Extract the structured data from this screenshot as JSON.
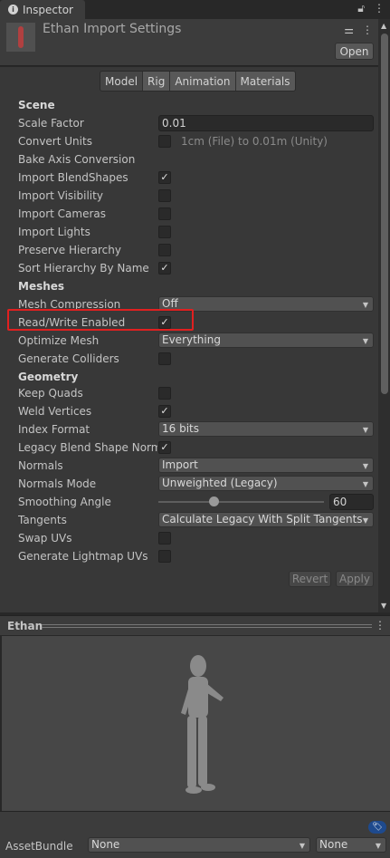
{
  "tab": {
    "title": "Inspector",
    "icon": "info-icon"
  },
  "header": {
    "title": "Ethan Import Settings",
    "open_label": "Open",
    "icons": [
      "lock-icon",
      "more-icon",
      "sliders-icon"
    ]
  },
  "tabs": [
    {
      "label": "Model",
      "active": true
    },
    {
      "label": "Rig"
    },
    {
      "label": "Animation"
    },
    {
      "label": "Materials"
    }
  ],
  "rows": [
    {
      "type": "header",
      "label": "Scene"
    },
    {
      "label": "Scale Factor",
      "type": "text",
      "value": "0.01"
    },
    {
      "label": "Convert Units",
      "type": "check",
      "checked": false,
      "note": "1cm (File) to 0.01m (Unity)"
    },
    {
      "label": "Bake Axis Conversion",
      "type": "none"
    },
    {
      "label": "Import BlendShapes",
      "type": "check",
      "checked": true
    },
    {
      "label": "Import Visibility",
      "type": "check",
      "checked": false
    },
    {
      "label": "Import Cameras",
      "type": "check",
      "checked": false
    },
    {
      "label": "Import Lights",
      "type": "check",
      "checked": false
    },
    {
      "label": "Preserve Hierarchy",
      "type": "check",
      "checked": false
    },
    {
      "label": "Sort Hierarchy By Name",
      "type": "check",
      "checked": true
    },
    {
      "type": "header",
      "label": "Meshes"
    },
    {
      "label": "Mesh Compression",
      "type": "dropdown",
      "value": "Off"
    },
    {
      "label": "Read/Write Enabled",
      "type": "check",
      "checked": true,
      "highlighted": true
    },
    {
      "label": "Optimize Mesh",
      "type": "dropdown",
      "value": "Everything"
    },
    {
      "label": "Generate Colliders",
      "type": "check",
      "checked": false
    },
    {
      "type": "header",
      "label": "Geometry"
    },
    {
      "label": "Keep Quads",
      "type": "check",
      "checked": false
    },
    {
      "label": "Weld Vertices",
      "type": "check",
      "checked": true
    },
    {
      "label": "Index Format",
      "type": "dropdown",
      "value": "16 bits"
    },
    {
      "label": "Legacy Blend Shape Normals",
      "type": "check",
      "checked": true
    },
    {
      "label": "Normals",
      "type": "dropdown",
      "value": "Import"
    },
    {
      "label": "Normals Mode",
      "type": "dropdown",
      "value": "Unweighted (Legacy)"
    },
    {
      "label": "Smoothing Angle",
      "type": "slider",
      "value": "60",
      "min": 0,
      "max": 180
    },
    {
      "label": "Tangents",
      "type": "dropdown",
      "value": "Calculate Legacy With Split Tangents"
    },
    {
      "label": "Swap UVs",
      "type": "check",
      "checked": false
    },
    {
      "label": "Generate Lightmap UVs",
      "type": "check",
      "checked": false
    }
  ],
  "footer": {
    "revert_label": "Revert",
    "apply_label": "Apply"
  },
  "preview": {
    "title": "Ethan"
  },
  "assetbundle": {
    "label": "AssetBundle",
    "name": "None",
    "variant": "None"
  },
  "colors": {
    "highlight": "#e02020",
    "panel": "#383838",
    "tag": "#1e4a8e"
  }
}
